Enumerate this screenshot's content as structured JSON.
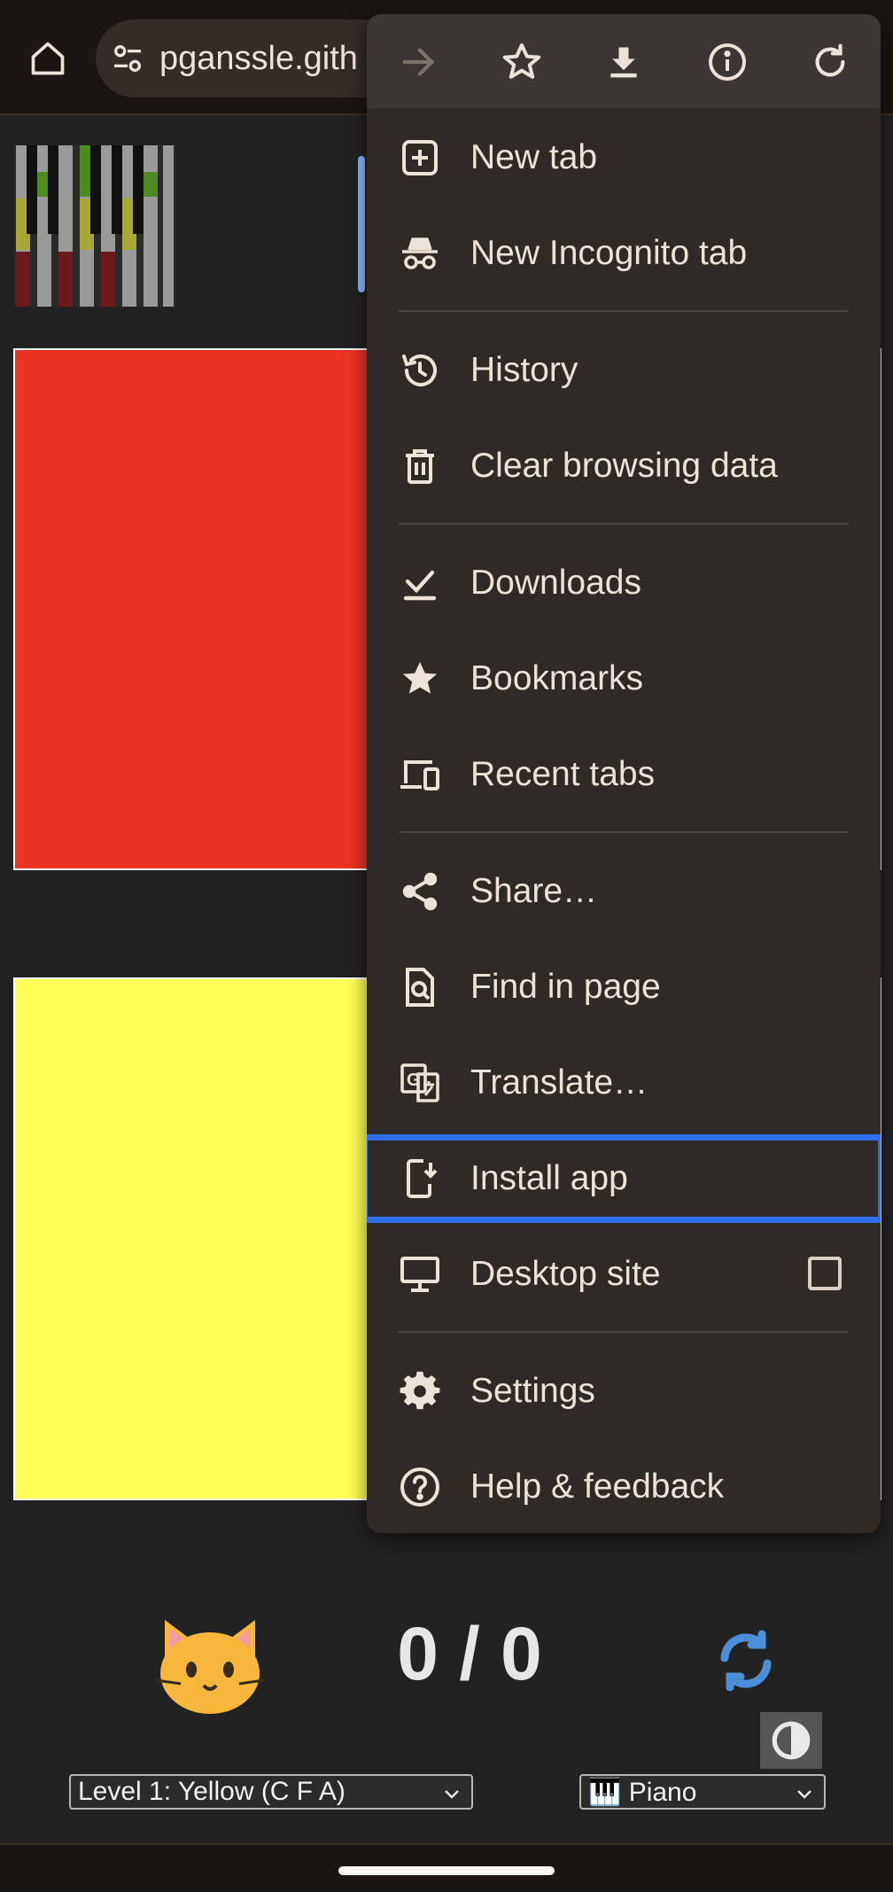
{
  "browser": {
    "url": "pganssle.gith",
    "icons": {
      "home": "home-icon",
      "site_info": "tune-icon"
    }
  },
  "menu": {
    "actions": [
      {
        "name": "forward-icon",
        "enabled": false
      },
      {
        "name": "star-icon",
        "enabled": true
      },
      {
        "name": "download-icon",
        "enabled": true
      },
      {
        "name": "info-icon",
        "enabled": true
      },
      {
        "name": "refresh-icon",
        "enabled": true
      }
    ],
    "items": {
      "new_tab": "New tab",
      "new_incognito_tab": "New Incognito tab",
      "history": "History",
      "clear_browsing_data": "Clear browsing data",
      "downloads": "Downloads",
      "bookmarks": "Bookmarks",
      "recent_tabs": "Recent tabs",
      "share": "Share…",
      "find_in_page": "Find in page",
      "translate": "Translate…",
      "install_app": "Install app",
      "desktop_site": "Desktop site",
      "settings": "Settings",
      "help_feedback": "Help & feedback"
    },
    "desktop_site_checked": false,
    "highlighted_item": "Install app",
    "highlight_color": "#2f6ef0"
  },
  "page": {
    "blocks": [
      {
        "color": "#e93423"
      },
      {
        "color": "#ffff54"
      }
    ],
    "score": "0 / 0",
    "cat_emoji": "🐱",
    "level_select": "Level 1: Yellow (C F A)",
    "instrument_select": "🎹 Piano",
    "accent_color": "#8ab4f8"
  }
}
